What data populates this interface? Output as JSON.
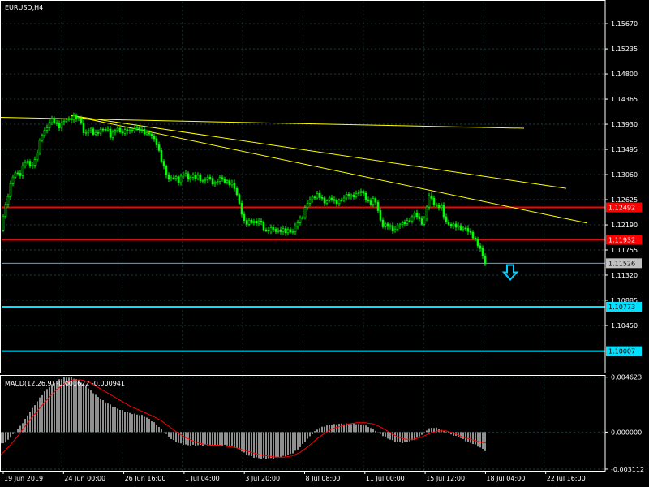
{
  "header": {
    "symbol_label": "EURUSD,H4"
  },
  "colors": {
    "background": "#000000",
    "grid": "#1e3c3c",
    "candle_up": "#00ff00",
    "candle_down": "#00ff00",
    "trend": "#ffff00",
    "resistance": "#ff0000",
    "support": "#00e0ff",
    "current_price": "#8899aa",
    "macd_hist": "#c0c0c0",
    "macd_signal": "#ff0000",
    "axis_text": "#ffffff",
    "arrow": "#00d0ff"
  },
  "chart_data": [
    {
      "type": "candlestick",
      "title": "EURUSD,H4",
      "y_ticks": [
        "1.15670",
        "1.15235",
        "1.14800",
        "1.14365",
        "1.13930",
        "1.13495",
        "1.13060",
        "1.12625",
        "1.12190",
        "1.11755",
        "1.11320",
        "1.10885",
        "1.10450"
      ],
      "x_ticks": [
        "19 Jun 2019",
        "24 Jun 00:00",
        "26 Jun 16:00",
        "1 Jul 04:00",
        "3 Jul 20:00",
        "8 Jul 08:00",
        "11 Jul 00:00",
        "15 Jul 12:00",
        "18 Jul 04:00",
        "22 Jul 16:00"
      ],
      "ylim": [
        1.0965,
        1.1605
      ],
      "close_path": [
        [
          0,
          1.121
        ],
        [
          4,
          1.1235
        ],
        [
          8,
          1.126
        ],
        [
          12,
          1.1285
        ],
        [
          16,
          1.13
        ],
        [
          20,
          1.131
        ],
        [
          24,
          1.1305
        ],
        [
          28,
          1.132
        ],
        [
          32,
          1.133
        ],
        [
          36,
          1.132
        ],
        [
          40,
          1.1325
        ],
        [
          44,
          1.1335
        ],
        [
          48,
          1.1355
        ],
        [
          52,
          1.1375
        ],
        [
          56,
          1.1385
        ],
        [
          60,
          1.1395
        ],
        [
          64,
          1.14
        ],
        [
          68,
          1.1395
        ],
        [
          72,
          1.139
        ],
        [
          76,
          1.1395
        ],
        [
          80,
          1.1398
        ],
        [
          84,
          1.14
        ],
        [
          88,
          1.1405
        ],
        [
          92,
          1.1408
        ],
        [
          96,
          1.14
        ],
        [
          100,
          1.1395
        ],
        [
          104,
          1.1375
        ],
        [
          108,
          1.1385
        ],
        [
          112,
          1.138
        ],
        [
          116,
          1.1375
        ],
        [
          120,
          1.138
        ],
        [
          124,
          1.1385
        ],
        [
          128,
          1.138
        ],
        [
          132,
          1.1385
        ],
        [
          136,
          1.1375
        ],
        [
          140,
          1.138
        ],
        [
          144,
          1.1385
        ],
        [
          148,
          1.1378
        ],
        [
          152,
          1.1382
        ],
        [
          156,
          1.1385
        ],
        [
          160,
          1.1378
        ],
        [
          164,
          1.1382
        ],
        [
          168,
          1.139
        ],
        [
          172,
          1.1385
        ],
        [
          176,
          1.1378
        ],
        [
          180,
          1.1375
        ],
        [
          184,
          1.138
        ],
        [
          188,
          1.1372
        ],
        [
          192,
          1.136
        ],
        [
          196,
          1.1345
        ],
        [
          200,
          1.133
        ],
        [
          204,
          1.131
        ],
        [
          208,
          1.1295
        ],
        [
          212,
          1.13
        ],
        [
          216,
          1.1305
        ],
        [
          220,
          1.1295
        ],
        [
          224,
          1.13
        ],
        [
          228,
          1.131
        ],
        [
          232,
          1.13
        ],
        [
          236,
          1.1305
        ],
        [
          240,
          1.1298
        ],
        [
          244,
          1.1302
        ],
        [
          248,
          1.1298
        ],
        [
          252,
          1.1295
        ],
        [
          256,
          1.13
        ],
        [
          260,
          1.1295
        ],
        [
          264,
          1.1292
        ],
        [
          268,
          1.1296
        ],
        [
          272,
          1.1298
        ],
        [
          276,
          1.1294
        ],
        [
          280,
          1.1296
        ],
        [
          284,
          1.129
        ],
        [
          288,
          1.1285
        ],
        [
          292,
          1.127
        ],
        [
          296,
          1.1255
        ],
        [
          300,
          1.1225
        ],
        [
          304,
          1.122
        ],
        [
          308,
          1.1225
        ],
        [
          312,
          1.1228
        ],
        [
          316,
          1.1222
        ],
        [
          320,
          1.1225
        ],
        [
          324,
          1.1215
        ],
        [
          328,
          1.121
        ],
        [
          332,
          1.1212
        ],
        [
          336,
          1.121
        ],
        [
          340,
          1.1208
        ],
        [
          344,
          1.1212
        ],
        [
          348,
          1.121
        ],
        [
          352,
          1.1205
        ],
        [
          356,
          1.121
        ],
        [
          360,
          1.1208
        ],
        [
          364,
          1.1215
        ],
        [
          368,
          1.1225
        ],
        [
          372,
          1.123
        ],
        [
          376,
          1.125
        ],
        [
          380,
          1.126
        ],
        [
          384,
          1.1262
        ],
        [
          388,
          1.1268
        ],
        [
          392,
          1.1275
        ],
        [
          396,
          1.1265
        ],
        [
          400,
          1.1255
        ],
        [
          404,
          1.1262
        ],
        [
          408,
          1.127
        ],
        [
          412,
          1.1258
        ],
        [
          416,
          1.1255
        ],
        [
          420,
          1.1262
        ],
        [
          424,
          1.1268
        ],
        [
          428,
          1.1272
        ],
        [
          432,
          1.1265
        ],
        [
          436,
          1.127
        ],
        [
          440,
          1.1275
        ],
        [
          444,
          1.1278
        ],
        [
          448,
          1.127
        ],
        [
          452,
          1.1262
        ],
        [
          456,
          1.1258
        ],
        [
          460,
          1.1262
        ],
        [
          464,
          1.1255
        ],
        [
          468,
          1.123
        ],
        [
          472,
          1.122
        ],
        [
          476,
          1.1218
        ],
        [
          480,
          1.1215
        ],
        [
          484,
          1.121
        ],
        [
          488,
          1.1215
        ],
        [
          492,
          1.122
        ],
        [
          496,
          1.1218
        ],
        [
          500,
          1.1225
        ],
        [
          504,
          1.1228
        ],
        [
          508,
          1.1232
        ],
        [
          512,
          1.1238
        ],
        [
          516,
          1.123
        ],
        [
          520,
          1.1225
        ],
        [
          524,
          1.123
        ],
        [
          528,
          1.1268
        ],
        [
          532,
          1.1265
        ],
        [
          536,
          1.1255
        ],
        [
          540,
          1.125
        ],
        [
          544,
          1.1248
        ],
        [
          548,
          1.123
        ],
        [
          552,
          1.1222
        ],
        [
          556,
          1.1218
        ],
        [
          560,
          1.1215
        ],
        [
          564,
          1.1218
        ],
        [
          568,
          1.1215
        ],
        [
          572,
          1.1212
        ],
        [
          576,
          1.1208
        ],
        [
          580,
          1.1205
        ],
        [
          584,
          1.12
        ],
        [
          588,
          1.1185
        ],
        [
          592,
          1.1175
        ],
        [
          596,
          1.1162
        ],
        [
          599,
          1.1152
        ]
      ],
      "trendlines": [
        {
          "from": [
            0,
            1.1405
          ],
          "to": [
            646,
            1.1386
          ]
        },
        {
          "from": [
            88,
            1.1408
          ],
          "to": [
            698,
            1.1282
          ]
        },
        {
          "from": [
            88,
            1.1408
          ],
          "to": [
            724,
            1.1222
          ]
        }
      ],
      "horizontal_levels": [
        {
          "value": 1.12492,
          "label": "1.12492",
          "kind": "resistance"
        },
        {
          "value": 1.11932,
          "label": "1.11932",
          "kind": "resistance"
        },
        {
          "value": 1.10773,
          "label": "1.10773",
          "kind": "support"
        },
        {
          "value": 1.10007,
          "label": "1.10007",
          "kind": "support"
        }
      ],
      "current_price": {
        "value": 1.11526,
        "label": "1.11526"
      },
      "arrow_down": {
        "x": 629,
        "price": 1.1137
      }
    },
    {
      "type": "macd",
      "title": "MACD(12,26,9) -0.001622 -0.000941",
      "y_ticks": [
        "0.004623",
        "0.000000",
        "-0.003112"
      ],
      "ylim": [
        -0.00325,
        0.00474
      ],
      "histogram_path": [
        [
          0,
          -0.001
        ],
        [
          8,
          -0.0008
        ],
        [
          16,
          -0.0002
        ],
        [
          24,
          0.0004
        ],
        [
          32,
          0.0012
        ],
        [
          40,
          0.002
        ],
        [
          48,
          0.0028
        ],
        [
          56,
          0.0035
        ],
        [
          64,
          0.004
        ],
        [
          72,
          0.0044
        ],
        [
          80,
          0.0046
        ],
        [
          88,
          0.0046
        ],
        [
          96,
          0.0044
        ],
        [
          104,
          0.004
        ],
        [
          112,
          0.0035
        ],
        [
          120,
          0.003
        ],
        [
          128,
          0.0026
        ],
        [
          136,
          0.0023
        ],
        [
          144,
          0.002
        ],
        [
          152,
          0.0018
        ],
        [
          160,
          0.0016
        ],
        [
          168,
          0.0015
        ],
        [
          176,
          0.0014
        ],
        [
          184,
          0.0011
        ],
        [
          192,
          0.0007
        ],
        [
          200,
          0.0002
        ],
        [
          208,
          -0.0004
        ],
        [
          216,
          -0.0008
        ],
        [
          224,
          -0.001
        ],
        [
          232,
          -0.0011
        ],
        [
          240,
          -0.0011
        ],
        [
          248,
          -0.0011
        ],
        [
          256,
          -0.0011
        ],
        [
          264,
          -0.0011
        ],
        [
          272,
          -0.0011
        ],
        [
          280,
          -0.0011
        ],
        [
          288,
          -0.0012
        ],
        [
          296,
          -0.0015
        ],
        [
          304,
          -0.0019
        ],
        [
          312,
          -0.0021
        ],
        [
          320,
          -0.0022
        ],
        [
          328,
          -0.0022
        ],
        [
          336,
          -0.0022
        ],
        [
          344,
          -0.0021
        ],
        [
          352,
          -0.002
        ],
        [
          360,
          -0.0018
        ],
        [
          368,
          -0.0014
        ],
        [
          376,
          -0.0008
        ],
        [
          384,
          -0.0002
        ],
        [
          392,
          0.0003
        ],
        [
          400,
          0.0005
        ],
        [
          408,
          0.0006
        ],
        [
          416,
          0.0007
        ],
        [
          424,
          0.0007
        ],
        [
          432,
          0.0007
        ],
        [
          440,
          0.0007
        ],
        [
          448,
          0.0006
        ],
        [
          456,
          0.0004
        ],
        [
          464,
          0.0001
        ],
        [
          472,
          -0.0003
        ],
        [
          480,
          -0.0006
        ],
        [
          488,
          -0.0008
        ],
        [
          496,
          -0.0009
        ],
        [
          504,
          -0.0008
        ],
        [
          512,
          -0.0006
        ],
        [
          520,
          -0.0002
        ],
        [
          528,
          0.0003
        ],
        [
          536,
          0.0004
        ],
        [
          544,
          0.0002
        ],
        [
          552,
          -0.0001
        ],
        [
          560,
          -0.0003
        ],
        [
          568,
          -0.0005
        ],
        [
          576,
          -0.0008
        ],
        [
          584,
          -0.001
        ],
        [
          592,
          -0.0013
        ],
        [
          599,
          -0.0016
        ]
      ],
      "signal_path": [
        [
          0,
          -0.002
        ],
        [
          10,
          -0.0013
        ],
        [
          20,
          -0.0005
        ],
        [
          30,
          0.0004
        ],
        [
          40,
          0.0013
        ],
        [
          50,
          0.0021
        ],
        [
          60,
          0.0029
        ],
        [
          70,
          0.0036
        ],
        [
          80,
          0.0041
        ],
        [
          90,
          0.0044
        ],
        [
          100,
          0.0044
        ],
        [
          110,
          0.0042
        ],
        [
          120,
          0.0038
        ],
        [
          130,
          0.0034
        ],
        [
          140,
          0.003
        ],
        [
          150,
          0.0026
        ],
        [
          160,
          0.0022
        ],
        [
          170,
          0.0019
        ],
        [
          180,
          0.0016
        ],
        [
          190,
          0.0013
        ],
        [
          200,
          0.0009
        ],
        [
          210,
          0.0004
        ],
        [
          220,
          -0.0001
        ],
        [
          230,
          -0.0005
        ],
        [
          240,
          -0.0008
        ],
        [
          250,
          -0.001
        ],
        [
          260,
          -0.0011
        ],
        [
          270,
          -0.0011
        ],
        [
          280,
          -0.0012
        ],
        [
          290,
          -0.0013
        ],
        [
          300,
          -0.0015
        ],
        [
          310,
          -0.0017
        ],
        [
          320,
          -0.0019
        ],
        [
          330,
          -0.002
        ],
        [
          340,
          -0.0021
        ],
        [
          350,
          -0.0021
        ],
        [
          360,
          -0.002
        ],
        [
          370,
          -0.0017
        ],
        [
          380,
          -0.0012
        ],
        [
          390,
          -0.0006
        ],
        [
          400,
          -0.0001
        ],
        [
          410,
          0.0003
        ],
        [
          420,
          0.0005
        ],
        [
          430,
          0.0007
        ],
        [
          440,
          0.0008
        ],
        [
          450,
          0.0008
        ],
        [
          460,
          0.0007
        ],
        [
          470,
          0.0004
        ],
        [
          480,
          0.0
        ],
        [
          490,
          -0.0004
        ],
        [
          500,
          -0.0006
        ],
        [
          510,
          -0.0006
        ],
        [
          520,
          -0.0004
        ],
        [
          530,
          -0.0001
        ],
        [
          540,
          0.0001
        ],
        [
          550,
          0.0001
        ],
        [
          560,
          -0.0001
        ],
        [
          570,
          -0.0004
        ],
        [
          580,
          -0.0006
        ],
        [
          590,
          -0.0008
        ],
        [
          599,
          -0.0009
        ]
      ]
    }
  ]
}
